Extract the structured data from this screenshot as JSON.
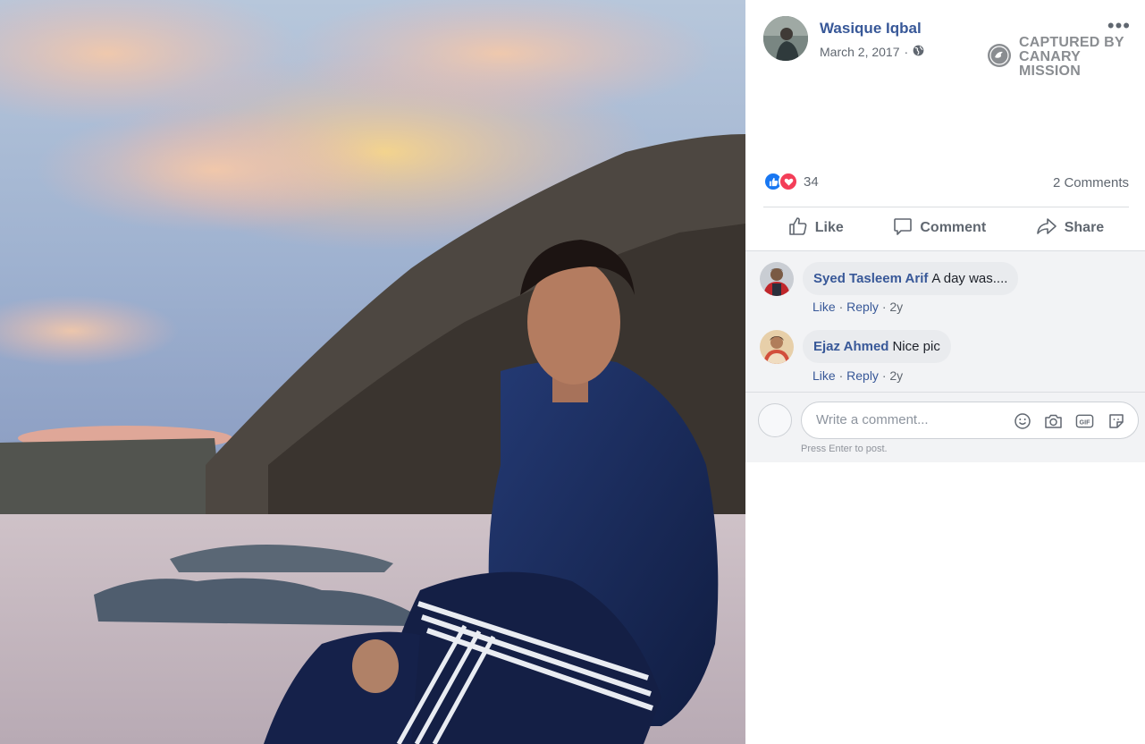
{
  "post": {
    "author": "Wasique Iqbal",
    "date": "March 2, 2017",
    "separator": "·",
    "privacy_icon": "globe-icon",
    "more_icon": "more-options-icon",
    "more_label": "•••"
  },
  "watermark": {
    "line1": "CAPTURED BY",
    "line2": "CANARY MISSION",
    "icon": "canary-bird-icon"
  },
  "reactions": {
    "types": [
      "like-reaction-icon",
      "love-reaction-icon"
    ],
    "count": "34",
    "comments_label": "2 Comments"
  },
  "actions": [
    {
      "label": "Like",
      "icon": "thumbs-up-icon"
    },
    {
      "label": "Comment",
      "icon": "comment-bubble-icon"
    },
    {
      "label": "Share",
      "icon": "share-arrow-icon"
    }
  ],
  "comments": [
    {
      "name": "Syed Tasleem Arif",
      "text": "A day was....",
      "like": "Like",
      "reply": "Reply",
      "dot": "·",
      "age": "2y"
    },
    {
      "name": "Ejaz Ahmed",
      "text": "Nice pic",
      "like": "Like",
      "reply": "Reply",
      "dot": "·",
      "age": "2y"
    }
  ],
  "composer": {
    "placeholder": "Write a comment...",
    "hint": "Press Enter to post.",
    "icons": [
      "emoji-icon",
      "camera-icon",
      "gif-icon",
      "sticker-icon"
    ]
  },
  "colors": {
    "link_blue": "#385898",
    "like_blue": "#1877f2",
    "love_red": "#f33e58",
    "meta_gray": "#606770"
  }
}
